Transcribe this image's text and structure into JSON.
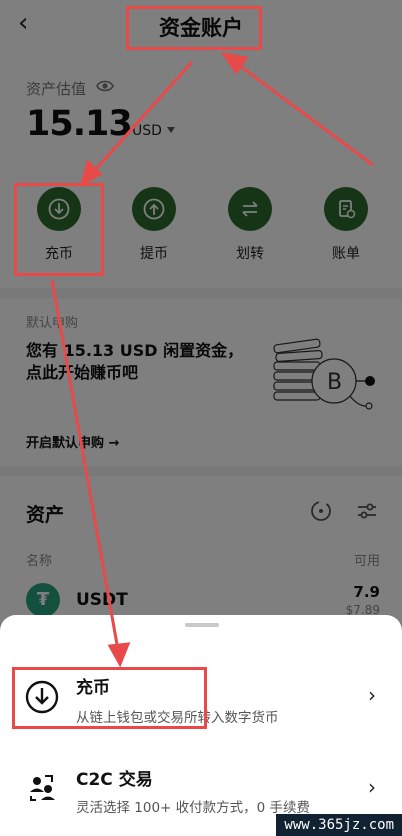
{
  "header": {
    "back_glyph": "‹",
    "title": "资金账户"
  },
  "balance": {
    "label": "资产估值",
    "amount": "15.13",
    "currency": "USD"
  },
  "actions": [
    {
      "label": "充币",
      "icon": "deposit-icon"
    },
    {
      "label": "提币",
      "icon": "withdraw-icon"
    },
    {
      "label": "划转",
      "icon": "transfer-icon"
    },
    {
      "label": "账单",
      "icon": "bill-icon"
    }
  ],
  "promo": {
    "heading": "默认申购",
    "text": "您有 15.13 USD 闲置资金，点此开始赚币吧",
    "link": "开启默认申购 →"
  },
  "assets": {
    "title": "资产",
    "col_name": "名称",
    "col_available": "可用",
    "items": [
      {
        "name": "USDT",
        "logo": "₮",
        "amount": "7.9",
        "usd": "$7.89"
      }
    ]
  },
  "sheet": {
    "options": [
      {
        "title": "充币",
        "desc": "从链上钱包或交易所转入数字货币",
        "icon": "deposit-icon"
      },
      {
        "title": "C2C 交易",
        "desc": "灵活选择 100+ 收付款方式，0 手续费",
        "icon": "c2c-users-icon"
      }
    ],
    "arrow": "›"
  },
  "watermark": "www.365jz.com",
  "colors": {
    "accent_green": "#2d6a2c",
    "annotation_red": "#e84a4a"
  }
}
